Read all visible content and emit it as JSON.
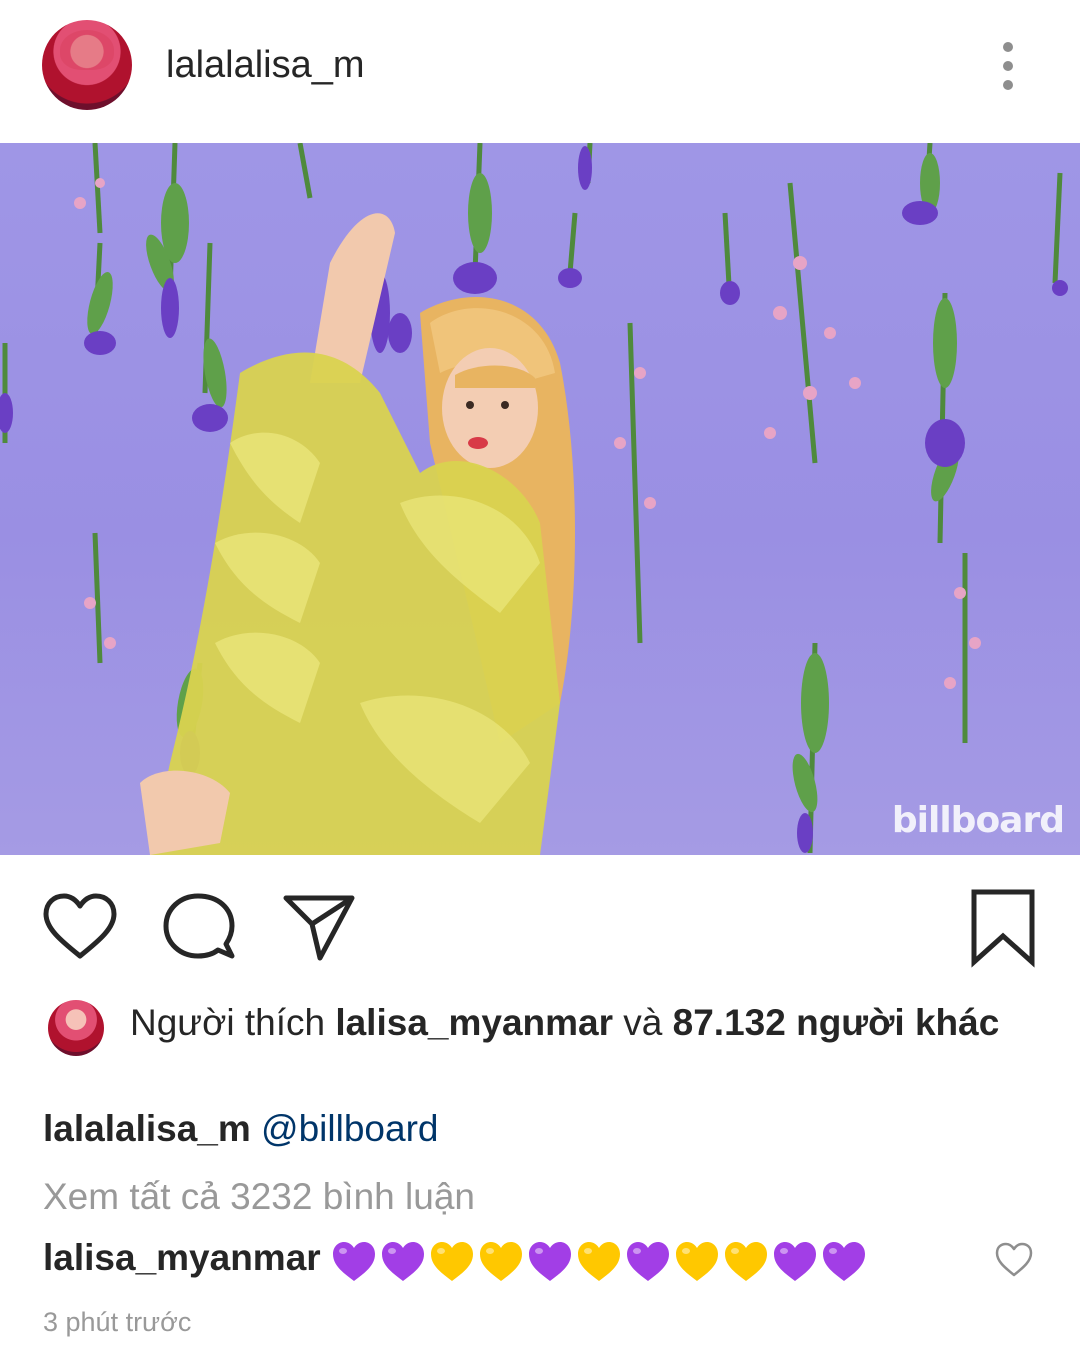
{
  "post": {
    "username": "lalalalisa_m",
    "photo_watermark": "billboard"
  },
  "likes": {
    "prefix": "Người thích",
    "user": "lalisa_myanmar",
    "joiner": "và",
    "count_text": "87.132 người khác"
  },
  "caption": {
    "username": "lalalalisa_m",
    "mention": "@billboard"
  },
  "comments": {
    "view_all": "Xem tất cả 3232 bình luận",
    "items": [
      {
        "username": "lalisa_myanmar",
        "emoji_sequence": [
          "purple-heart",
          "purple-heart",
          "yellow-heart",
          "yellow-heart",
          "purple-heart",
          "yellow-heart",
          "purple-heart",
          "yellow-heart",
          "yellow-heart",
          "purple-heart",
          "purple-heart"
        ]
      }
    ]
  },
  "timestamp": "3 phút trước",
  "colors": {
    "photo_background": "#9f96e6",
    "purple_heart": "#a23ee6",
    "yellow_heart": "#ffc800",
    "mention": "#003569",
    "secondary_text": "#999999"
  }
}
